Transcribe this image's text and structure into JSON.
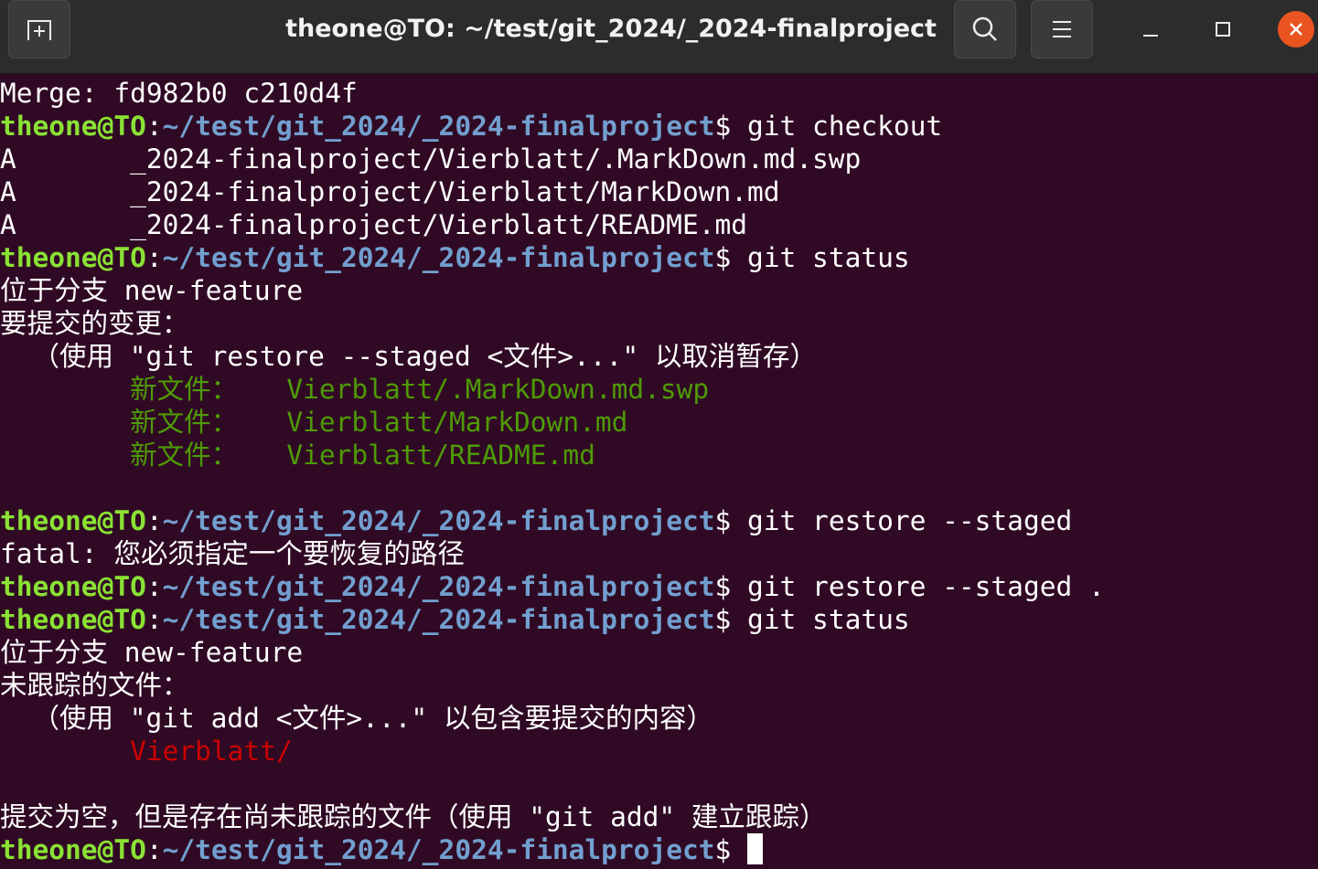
{
  "window": {
    "title": "theone@TO: ~/test/git_2024/_2024-finalproject",
    "icons": {
      "new_tab": "new-tab-icon",
      "search": "search-icon",
      "menu": "hamburger-menu-icon",
      "minimize": "minimize-icon",
      "maximize": "maximize-icon",
      "close": "close-icon"
    }
  },
  "colors": {
    "background": "#300a24",
    "prompt_user": "#8ae234",
    "prompt_path": "#729fcf",
    "staged_file": "#4e9a06",
    "untracked_file": "#cc0000",
    "close_button": "#e95420"
  },
  "prompt": {
    "user": "theone@TO",
    "sep": ":",
    "path": "~/test/git_2024/_2024-finalproject",
    "dollar": "$ "
  },
  "terminal": {
    "l01": "Merge: fd982b0 c210d4f",
    "l02_cmd": "git checkout",
    "l03": "A       _2024-finalproject/Vierblatt/.MarkDown.md.swp",
    "l04": "A       _2024-finalproject/Vierblatt/MarkDown.md",
    "l05": "A       _2024-finalproject/Vierblatt/README.md",
    "l06_cmd": "git status",
    "l07": "位于分支 new-feature",
    "l08": "要提交的变更：",
    "l09": "  （使用 \"git restore --staged <文件>...\" 以取消暂存）",
    "l10_indent": "        ",
    "l10_label": "新文件：",
    "l10_file": "   Vierblatt/.MarkDown.md.swp",
    "l11_indent": "        ",
    "l11_label": "新文件：",
    "l11_file": "   Vierblatt/MarkDown.md",
    "l12_indent": "        ",
    "l12_label": "新文件：",
    "l12_file": "   Vierblatt/README.md",
    "l14_cmd": "git restore --staged",
    "l15": "fatal: 您必须指定一个要恢复的路径",
    "l16_cmd": "git restore --staged .",
    "l17_cmd": "git status",
    "l18": "位于分支 new-feature",
    "l19": "未跟踪的文件：",
    "l20": "  （使用 \"git add <文件>...\" 以包含要提交的内容）",
    "l21_indent": "        ",
    "l21_file": "Vierblatt/",
    "l23": "提交为空，但是存在尚未跟踪的文件（使用 \"git add\" 建立跟踪）"
  }
}
